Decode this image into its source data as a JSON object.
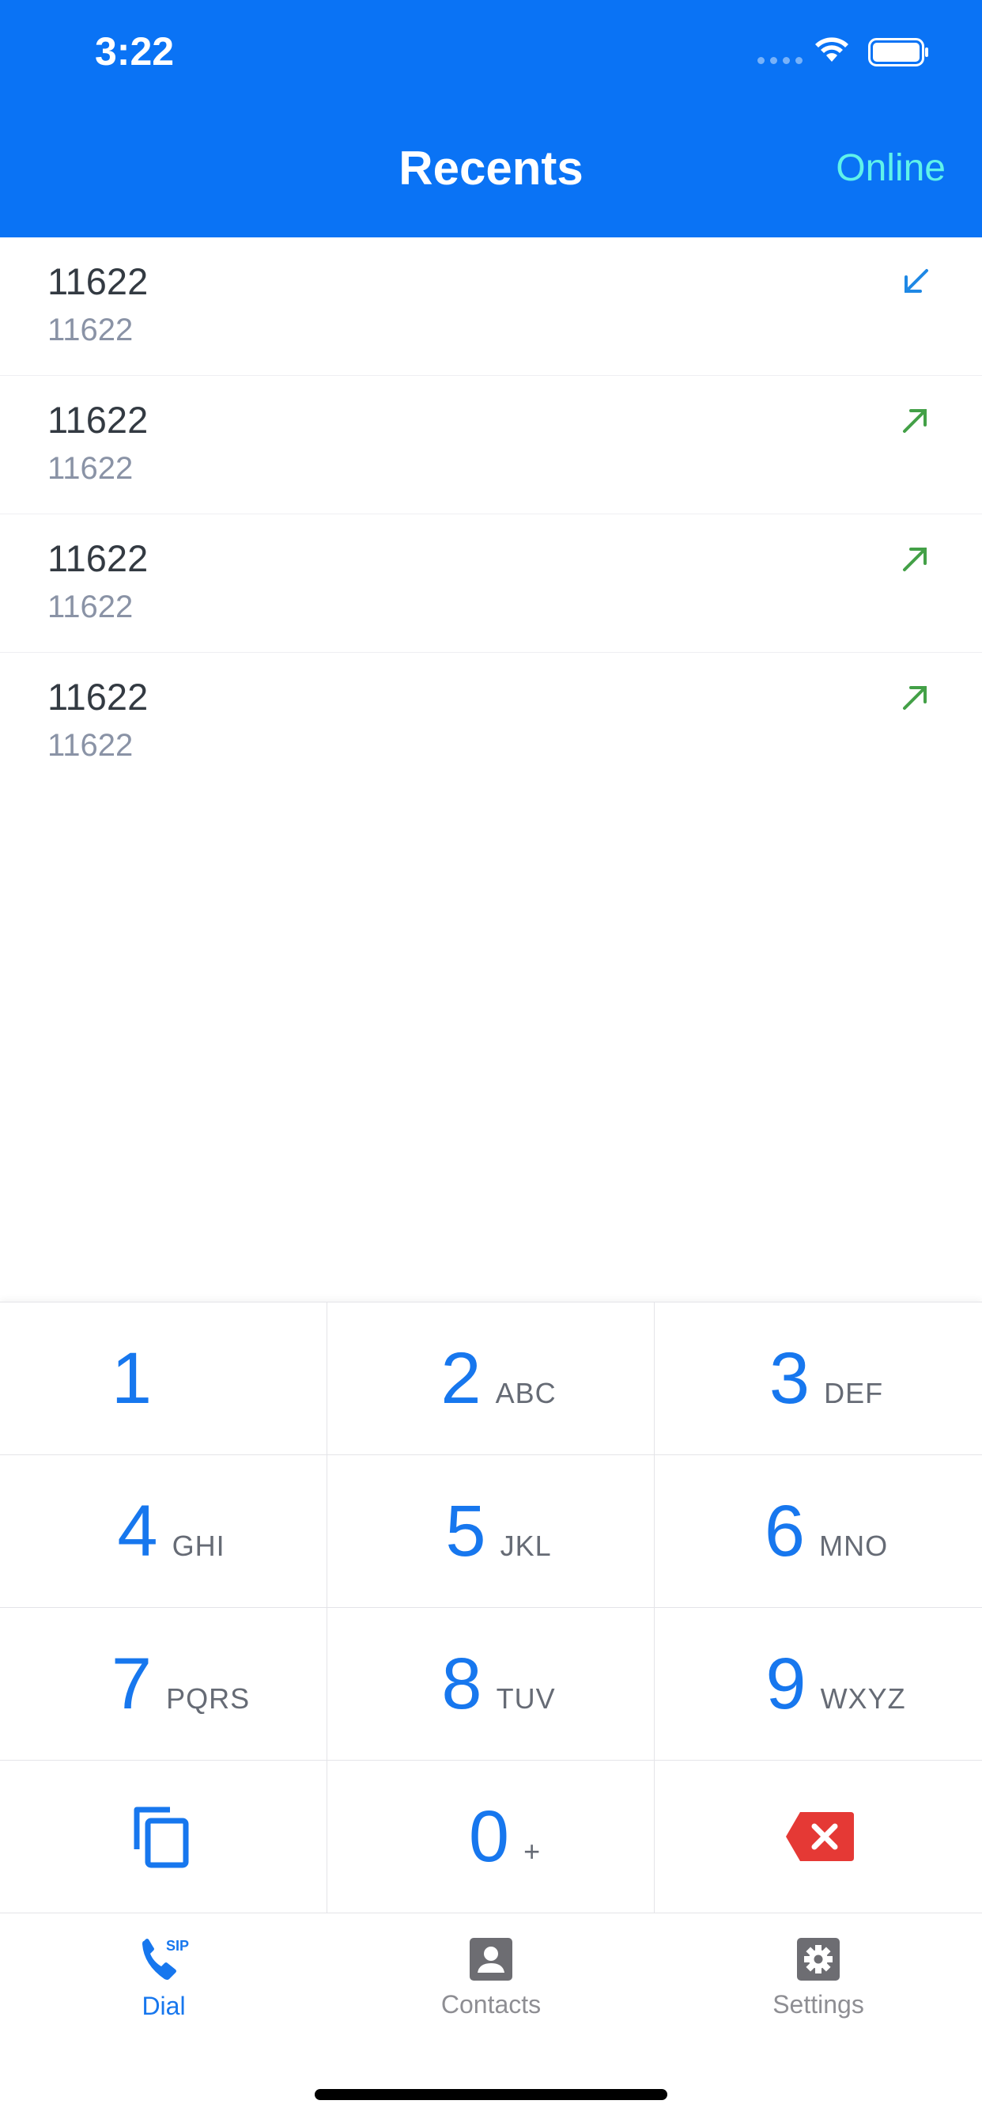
{
  "status_bar": {
    "time": "3:22"
  },
  "header": {
    "title": "Recents",
    "status": "Online"
  },
  "recents": [
    {
      "name": "11622",
      "number": "11622",
      "direction": "incoming",
      "direction_icon": "arrow-down-left-icon",
      "color": "#1e88e5"
    },
    {
      "name": "11622",
      "number": "11622",
      "direction": "outgoing",
      "direction_icon": "arrow-up-right-icon",
      "color": "#43a047"
    },
    {
      "name": "11622",
      "number": "11622",
      "direction": "outgoing",
      "direction_icon": "arrow-up-right-icon",
      "color": "#43a047"
    },
    {
      "name": "11622",
      "number": "11622",
      "direction": "outgoing",
      "direction_icon": "arrow-up-right-icon",
      "color": "#43a047"
    }
  ],
  "keypad": {
    "keys": [
      {
        "digit": "1",
        "letters": ""
      },
      {
        "digit": "2",
        "letters": "ABC"
      },
      {
        "digit": "3",
        "letters": "DEF"
      },
      {
        "digit": "4",
        "letters": "GHI"
      },
      {
        "digit": "5",
        "letters": "JKL"
      },
      {
        "digit": "6",
        "letters": "MNO"
      },
      {
        "digit": "7",
        "letters": "PQRS"
      },
      {
        "digit": "8",
        "letters": "TUV"
      },
      {
        "digit": "9",
        "letters": "WXYZ"
      },
      {
        "digit": "0",
        "letters": "+"
      }
    ],
    "copy_icon": "copy-icon",
    "delete_icon": "backspace-icon"
  },
  "tabs": [
    {
      "label": "Dial",
      "icon": "sip-phone-icon",
      "active": true
    },
    {
      "label": "Contacts",
      "icon": "contact-card-icon",
      "active": false
    },
    {
      "label": "Settings",
      "icon": "gear-icon",
      "active": false
    }
  ],
  "colors": {
    "accent": "#0a73f5",
    "online": "#5ff2ea",
    "key_digit": "#1777ee",
    "delete": "#e53935"
  }
}
